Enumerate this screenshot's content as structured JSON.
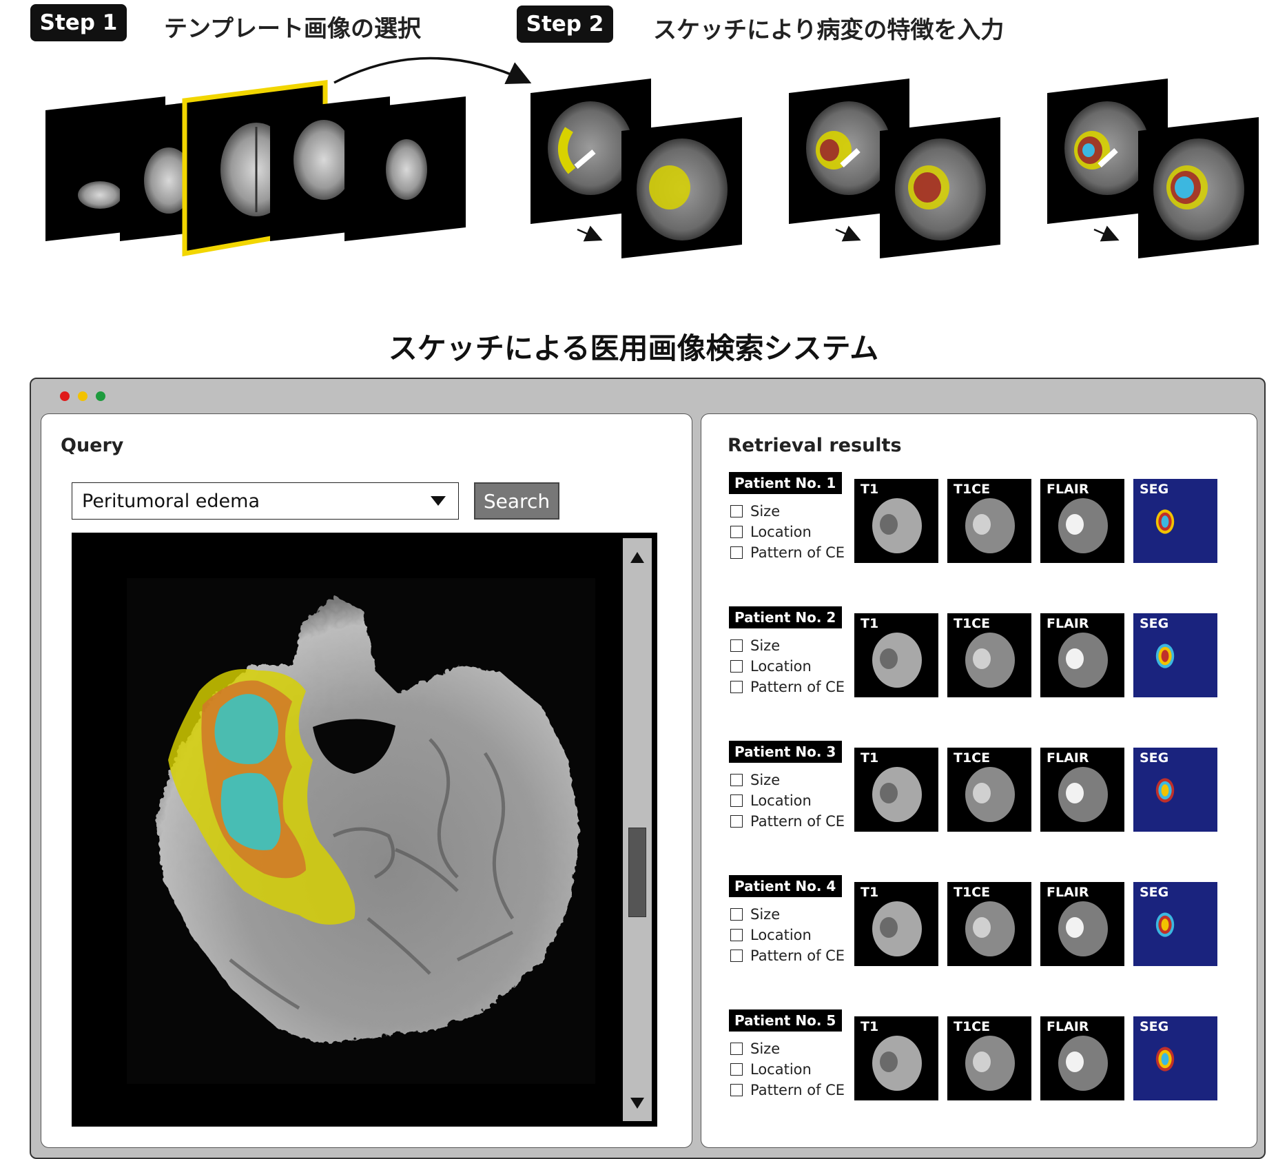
{
  "step1": {
    "badge": "Step 1",
    "title": "テンプレート画像の選択"
  },
  "step2": {
    "badge": "Step 2",
    "title": "スケッチにより病変の特徴を入力"
  },
  "main_title": "スケッチによる医用画像検索システム",
  "colors": {
    "edema": "#d8d200",
    "necrosis": "#d07a28",
    "enhancing": "#3cc2c0",
    "seg_background": "#1a237e",
    "template_highlight": "#f2d600"
  },
  "window": {
    "controls": [
      "close-dot",
      "minimize-dot",
      "maximize-dot"
    ]
  },
  "query": {
    "title": "Query",
    "dropdown_value": "Peritumoral edema",
    "search_label": "Search",
    "scroll_up_icon": "triangle-up-icon",
    "scroll_down_icon": "triangle-down-icon"
  },
  "results": {
    "title": "Retrieval results",
    "options": [
      "Size",
      "Location",
      "Pattern of CE"
    ],
    "modalities": [
      "T1",
      "T1CE",
      "FLAIR",
      "SEG"
    ],
    "patients": [
      {
        "label": "Patient No. 1"
      },
      {
        "label": "Patient No. 2"
      },
      {
        "label": "Patient No. 3"
      },
      {
        "label": "Patient No. 4"
      },
      {
        "label": "Patient No. 5"
      }
    ]
  }
}
